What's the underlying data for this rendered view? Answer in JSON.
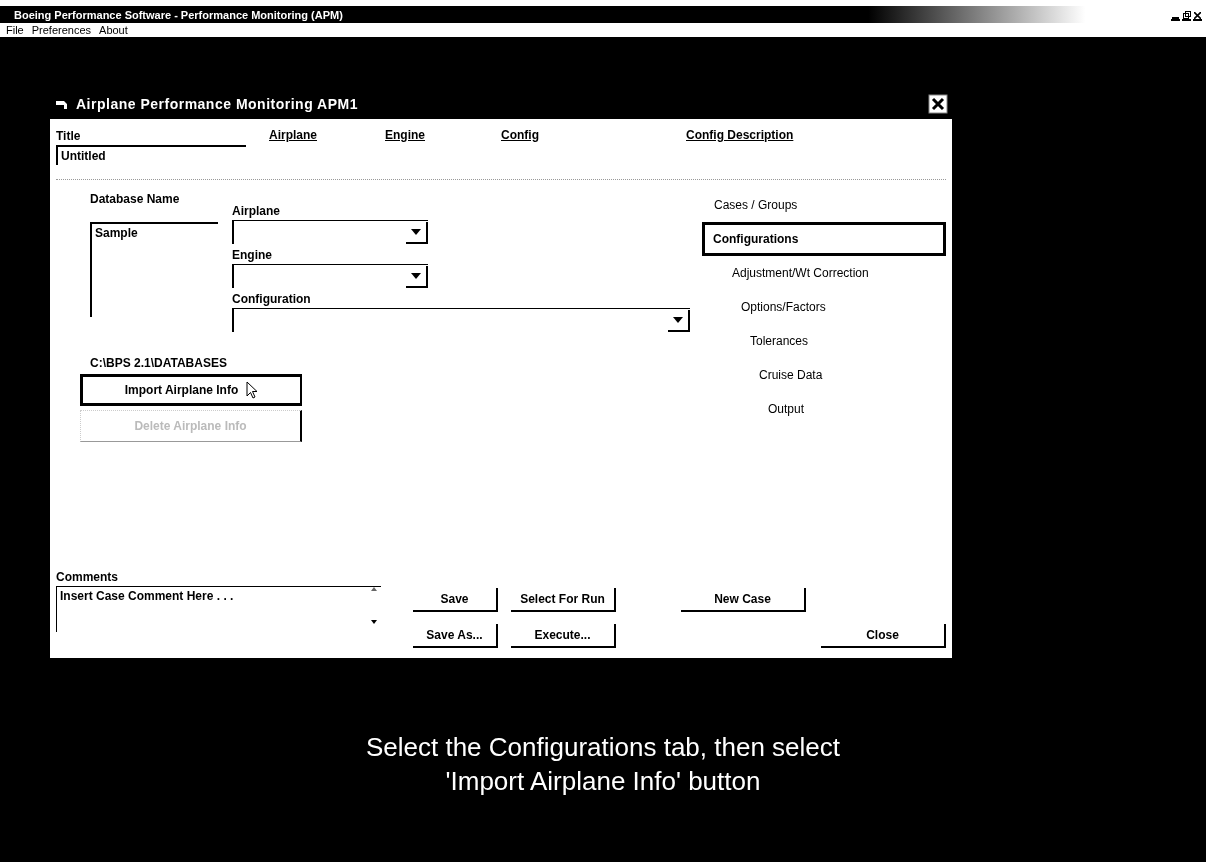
{
  "app_window": {
    "title": "Boeing Performance Software - Performance Monitoring (APM)",
    "menu": [
      "File",
      "Preferences",
      "About"
    ]
  },
  "dialog": {
    "title": "Airplane Performance Monitoring   APM1",
    "header": {
      "title_label": "Title",
      "title_value": "Untitled",
      "columns": [
        "Airplane",
        "Engine",
        "Config",
        "Config Description"
      ]
    },
    "database": {
      "label": "Database Name",
      "items": [
        "Sample"
      ],
      "path": "C:\\BPS 2.1\\DATABASES"
    },
    "selectors": [
      {
        "label": "Airplane",
        "kind": "short"
      },
      {
        "label": "Engine",
        "kind": "short"
      },
      {
        "label": "Configuration",
        "kind": "wide"
      }
    ],
    "buttons": [
      {
        "label": "Import Airplane Info",
        "focused": true,
        "disabled": false
      },
      {
        "label": "Delete Airplane Info",
        "focused": false,
        "disabled": true
      }
    ],
    "tabs": [
      {
        "label": "Cases / Groups",
        "selected": false
      },
      {
        "label": "Configurations",
        "selected": true
      },
      {
        "label": "Adjustment/Wt Correction",
        "selected": false
      },
      {
        "label": "Options/Factors",
        "selected": false
      },
      {
        "label": "Tolerances",
        "selected": false
      },
      {
        "label": "Cruise Data",
        "selected": false
      },
      {
        "label": "Output",
        "selected": false
      }
    ],
    "comments": {
      "label": "Comments",
      "value": "Insert Case Comment Here . . ."
    },
    "action_rows": [
      [
        "Save",
        "Select For Run",
        "New Case"
      ],
      [
        "Save As...",
        "Execute...",
        "Close"
      ]
    ]
  },
  "caption": [
    "Select the Configurations tab, then select",
    "'Import Airplane Info' button"
  ]
}
